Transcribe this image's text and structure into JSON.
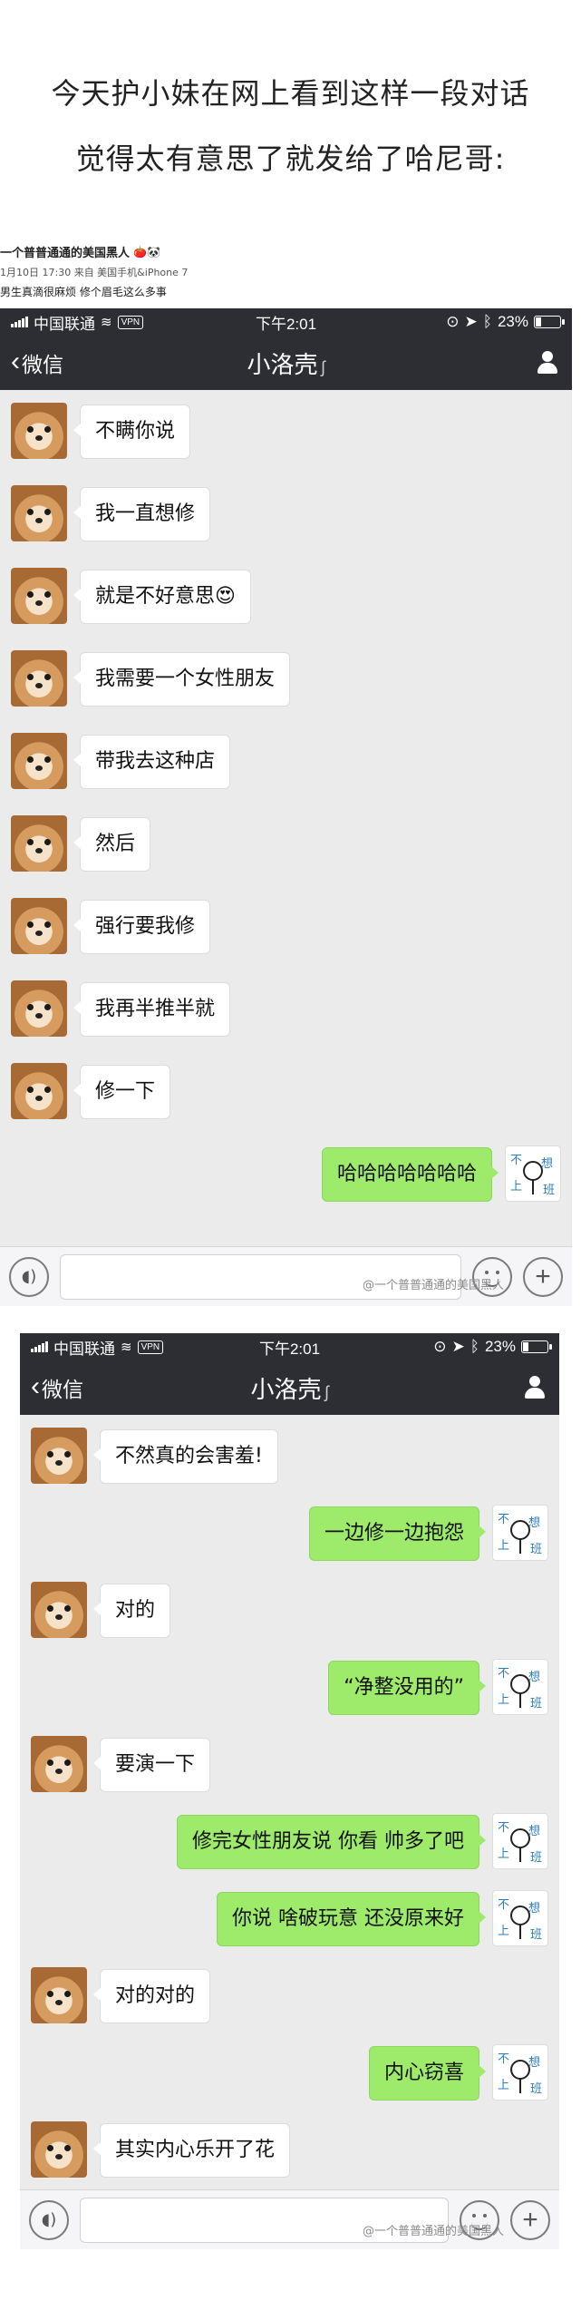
{
  "headline": {
    "line1": "今天护小妹在网上看到这样一段对话",
    "line2": "觉得太有意思了就发给了哈尼哥:"
  },
  "post": {
    "author": "一个普普通通的美国黑人",
    "author_emoji": "🍅🐼",
    "meta": "1月10日 17:30 来自 美国手机&iPhone 7",
    "caption": "男生真滴很麻烦 修个眉毛这么多事"
  },
  "status_bar": {
    "carrier": "中国联通",
    "vpn": "VPN",
    "time": "下午2:01",
    "battery": "23%",
    "battery_level": 0.23
  },
  "nav": {
    "back_label": "微信",
    "title": "小洛壳",
    "ear_icon": "ear-icon"
  },
  "conversation1": [
    {
      "dir": "in",
      "text": "不瞒你说"
    },
    {
      "dir": "in",
      "text": "我一直想修"
    },
    {
      "dir": "in",
      "text": "就是不好意思😍"
    },
    {
      "dir": "in",
      "text": "我需要一个女性朋友"
    },
    {
      "dir": "in",
      "text": "带我去这种店"
    },
    {
      "dir": "in",
      "text": "然后"
    },
    {
      "dir": "in",
      "text": "强行要我修"
    },
    {
      "dir": "in",
      "text": "我再半推半就"
    },
    {
      "dir": "in",
      "text": "修一下"
    },
    {
      "dir": "out",
      "text": "哈哈哈哈哈哈哈"
    }
  ],
  "conversation2": [
    {
      "dir": "in",
      "text": "不然真的会害羞!"
    },
    {
      "dir": "out",
      "text": "一边修一边抱怨"
    },
    {
      "dir": "in",
      "text": "对的"
    },
    {
      "dir": "out",
      "text": "“净整没用的”"
    },
    {
      "dir": "in",
      "text": "要演一下"
    },
    {
      "dir": "out",
      "text": "修完女性朋友说 你看 帅多了吧"
    },
    {
      "dir": "out",
      "text": "你说 啥破玩意 还没原来好"
    },
    {
      "dir": "in",
      "text": "对的对的"
    },
    {
      "dir": "out",
      "text": "内心窃喜"
    },
    {
      "dir": "in",
      "text": "其实内心乐开了花"
    }
  ],
  "my_avatar_chars": [
    "不",
    "想",
    "上",
    "班"
  ],
  "watermark": "@一个普普通通的美国黑人",
  "colors": {
    "bar": "#2d2e33",
    "chat_bg": "#ebebeb",
    "out_bubble": "#9eea6a",
    "in_bubble": "#ffffff"
  }
}
